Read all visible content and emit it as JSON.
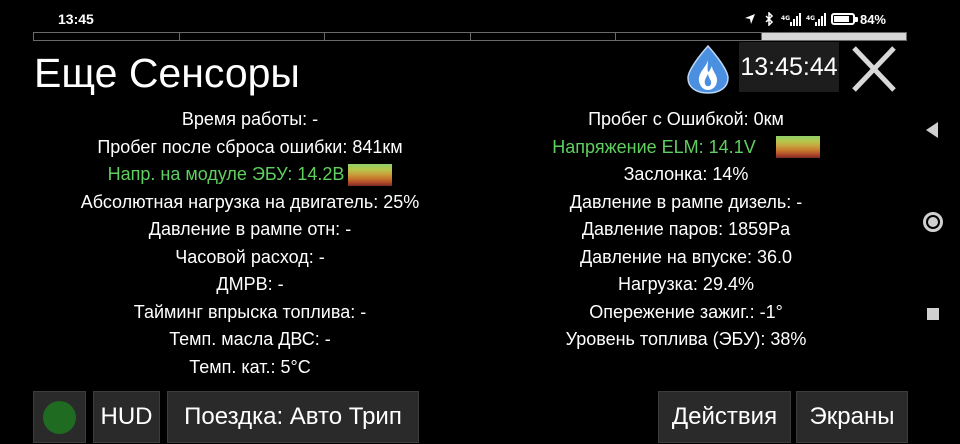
{
  "status_bar": {
    "time": "13:45",
    "battery_percent": "84%",
    "icons": [
      "location-icon",
      "bluetooth-icon",
      "signal-icon",
      "signal-icon",
      "battery-icon"
    ]
  },
  "header": {
    "title": "Еще Сенсоры",
    "clock": "13:45:44",
    "fuel_icon": "fuel-drop-flame-icon",
    "close_icon": "close-icon"
  },
  "sensors_left": [
    {
      "label": "Время работы: -",
      "highlight": false,
      "gauge": false
    },
    {
      "label": "Пробег после сброса ошибки: 841км",
      "highlight": false,
      "gauge": false
    },
    {
      "label": "Напр. на модуле ЭБУ: 14.2В",
      "highlight": true,
      "gauge": true
    },
    {
      "label": "Абсолютная нагрузка на двигатель: 25%",
      "highlight": false,
      "gauge": false
    },
    {
      "label": "Давление в рампе отн: -",
      "highlight": false,
      "gauge": false
    },
    {
      "label": "Часовой расход: -",
      "highlight": false,
      "gauge": false
    },
    {
      "label": "ДМРВ: -",
      "highlight": false,
      "gauge": false
    },
    {
      "label": "Тайминг впрыска топлива: -",
      "highlight": false,
      "gauge": false
    },
    {
      "label": "Темп. масла ДВС: -",
      "highlight": false,
      "gauge": false
    },
    {
      "label": "Темп. кат.: 5°C",
      "highlight": false,
      "gauge": false
    }
  ],
  "sensors_right": [
    {
      "label": "Пробег с Ошибкой: 0км",
      "highlight": false,
      "gauge": false
    },
    {
      "label": "Напряжение ELM: 14.1V",
      "highlight": true,
      "gauge": true
    },
    {
      "label": "Заслонка: 14%",
      "highlight": false,
      "gauge": false
    },
    {
      "label": "Давление в рампе дизель: -",
      "highlight": false,
      "gauge": false
    },
    {
      "label": "Давление паров: 1859Pa",
      "highlight": false,
      "gauge": false
    },
    {
      "label": "Давление на впуске: 36.0",
      "highlight": false,
      "gauge": false
    },
    {
      "label": "Нагрузка: 29.4%",
      "highlight": false,
      "gauge": false
    },
    {
      "label": "Опережение зажиг.: -1°",
      "highlight": false,
      "gauge": false
    },
    {
      "label": "Уровень топлива (ЭБУ): 38%",
      "highlight": false,
      "gauge": false
    }
  ],
  "bottom_bar": {
    "status_dot_color": "#1f6b22",
    "hud_label": "HUD",
    "trip_label": "Поездка: Авто Трип",
    "actions_label": "Действия",
    "screens_label": "Экраны"
  },
  "colors": {
    "background": "#000000",
    "highlight": "#5fd05f",
    "button_bg": "#2a2a2a"
  }
}
